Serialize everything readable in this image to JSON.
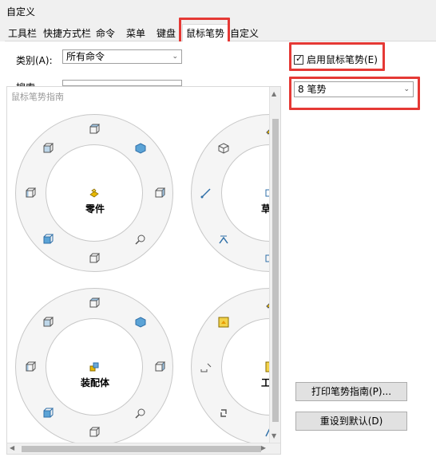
{
  "window": {
    "title": "自定义"
  },
  "tabs": [
    {
      "label": "工具栏"
    },
    {
      "label": "快捷方式栏"
    },
    {
      "label": "命令"
    },
    {
      "label": "菜单"
    },
    {
      "label": "键盘"
    },
    {
      "label": "鼠标笔势"
    },
    {
      "label": "自定义"
    }
  ],
  "active_tab": "鼠标笔势",
  "category": {
    "label": "类别(A):",
    "value": "所有命令"
  },
  "search": {
    "label": "搜索",
    "value": ""
  },
  "enable_gestures": {
    "label": "启用鼠标笔势(E)",
    "checked": true
  },
  "gesture_count": {
    "value": "8 笔势"
  },
  "guide": {
    "title": "鼠标笔势指南",
    "wheels": [
      {
        "name": "零件"
      },
      {
        "name": "草"
      },
      {
        "name": "装配体"
      },
      {
        "name": "工"
      }
    ]
  },
  "buttons": {
    "print_guide": "打印笔势指南(P)...",
    "reset_default": "重设到默认(D)"
  },
  "colors": {
    "highlight_border": "#e53935",
    "icon_blue": "#2f6fa8",
    "icon_yellow": "#e8b800"
  }
}
